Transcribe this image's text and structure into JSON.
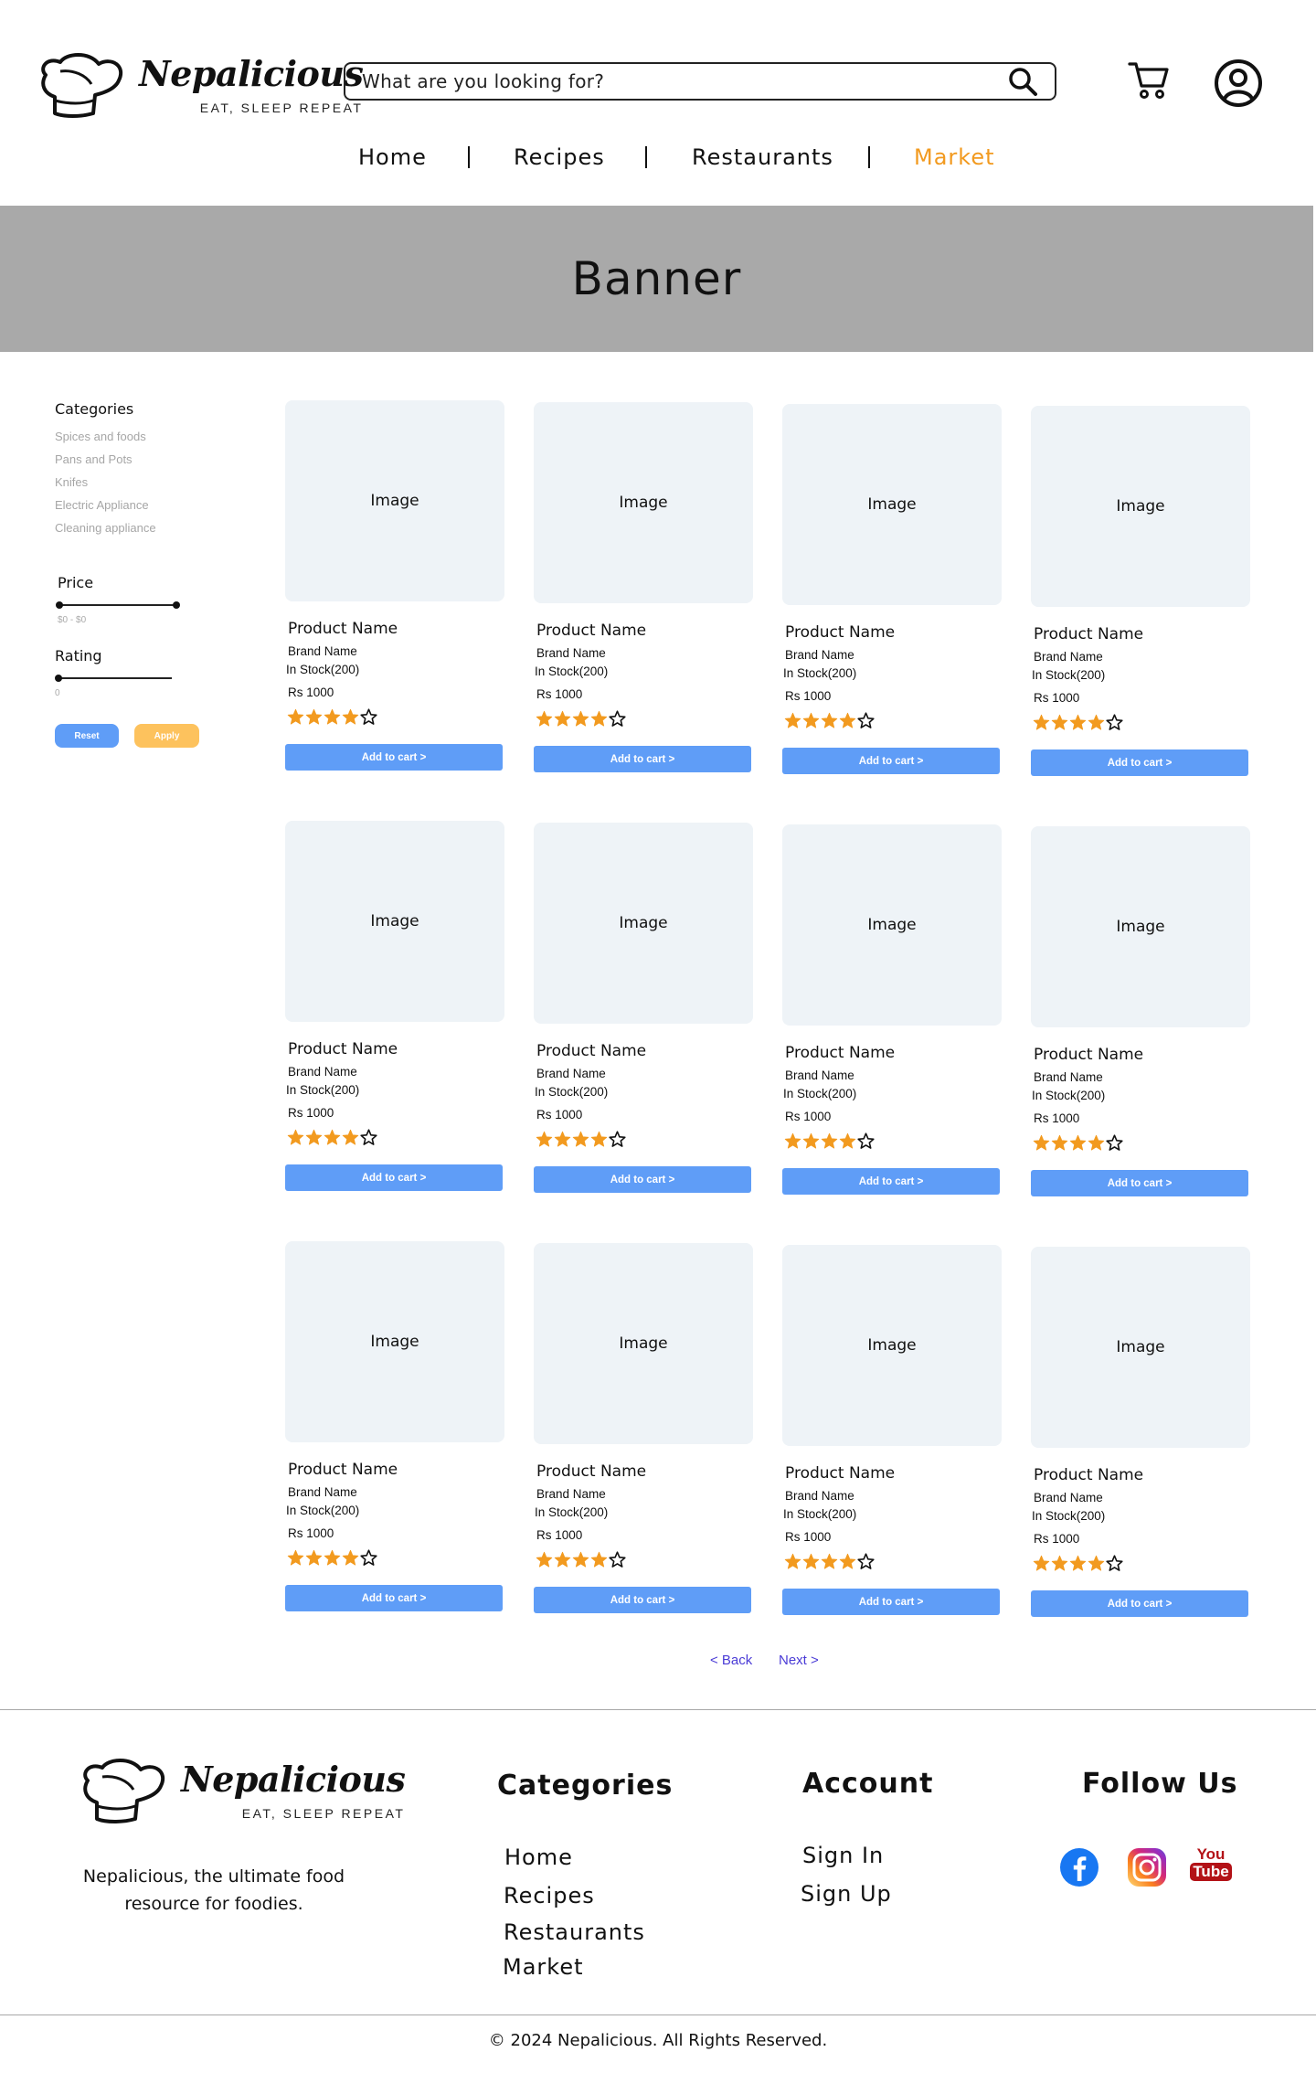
{
  "brand": {
    "name": "Nepalicious",
    "tagline": "EAT, SLEEP REPEAT"
  },
  "search": {
    "placeholder": "What are you looking for?"
  },
  "nav": {
    "items": [
      {
        "label": "Home",
        "active": false
      },
      {
        "label": "Recipes",
        "active": false
      },
      {
        "label": "Restaurants",
        "active": false
      },
      {
        "label": "Market",
        "active": true
      }
    ],
    "separator": "|"
  },
  "banner": {
    "label": "Banner"
  },
  "filters": {
    "categories_title": "Categories",
    "categories": [
      "Spices and foods",
      "Pans and Pots",
      "Knifes",
      "Electric Appliance",
      "Cleaning appliance"
    ],
    "price_title": "Price",
    "price_value": "$0 - $0",
    "rating_title": "Rating",
    "rating_value": "0",
    "reset_label": "Reset",
    "apply_label": "Apply"
  },
  "products": [
    {
      "image_label": "Image",
      "name": "Product Name",
      "brand": "Brand Name",
      "stock": "In Stock(200)",
      "price": "Rs 1000",
      "rating": 4,
      "cart_label": "Add to cart >"
    },
    {
      "image_label": "Image",
      "name": "Product Name",
      "brand": "Brand Name",
      "stock": "In Stock(200)",
      "price": "Rs 1000",
      "rating": 4,
      "cart_label": "Add to cart >"
    },
    {
      "image_label": "Image",
      "name": "Product Name",
      "brand": "Brand Name",
      "stock": "In Stock(200)",
      "price": "Rs 1000",
      "rating": 4,
      "cart_label": "Add to cart >"
    },
    {
      "image_label": "Image",
      "name": "Product Name",
      "brand": "Brand Name",
      "stock": "In Stock(200)",
      "price": "Rs 1000",
      "rating": 4,
      "cart_label": "Add to cart >"
    },
    {
      "image_label": "Image",
      "name": "Product Name",
      "brand": "Brand Name",
      "stock": "In Stock(200)",
      "price": "Rs 1000",
      "rating": 4,
      "cart_label": "Add to cart >"
    },
    {
      "image_label": "Image",
      "name": "Product Name",
      "brand": "Brand Name",
      "stock": "In Stock(200)",
      "price": "Rs 1000",
      "rating": 4,
      "cart_label": "Add to cart >"
    },
    {
      "image_label": "Image",
      "name": "Product Name",
      "brand": "Brand Name",
      "stock": "In Stock(200)",
      "price": "Rs 1000",
      "rating": 4,
      "cart_label": "Add to cart >"
    },
    {
      "image_label": "Image",
      "name": "Product Name",
      "brand": "Brand Name",
      "stock": "In Stock(200)",
      "price": "Rs 1000",
      "rating": 4,
      "cart_label": "Add to cart >"
    },
    {
      "image_label": "Image",
      "name": "Product Name",
      "brand": "Brand Name",
      "stock": "In Stock(200)",
      "price": "Rs 1000",
      "rating": 4,
      "cart_label": "Add to cart >"
    },
    {
      "image_label": "Image",
      "name": "Product Name",
      "brand": "Brand Name",
      "stock": "In Stock(200)",
      "price": "Rs 1000",
      "rating": 4,
      "cart_label": "Add to cart >"
    },
    {
      "image_label": "Image",
      "name": "Product Name",
      "brand": "Brand Name",
      "stock": "In Stock(200)",
      "price": "Rs 1000",
      "rating": 4,
      "cart_label": "Add to cart >"
    },
    {
      "image_label": "Image",
      "name": "Product Name",
      "brand": "Brand Name",
      "stock": "In Stock(200)",
      "price": "Rs 1000",
      "rating": 4,
      "cart_label": "Add to cart >"
    }
  ],
  "rating_max": 5,
  "pagination": {
    "back_label": "< Back",
    "next_label": "Next >"
  },
  "footer": {
    "description": "Nepalicious, the ultimate food resource for foodies.",
    "categories_title": "Categories",
    "categories_links": [
      "Home",
      "Recipes",
      "Restaurants",
      "Market"
    ],
    "account_title": "Account",
    "account_links": [
      "Sign In",
      "Sign Up"
    ],
    "follow_title": "Follow Us",
    "social": [
      {
        "icon": "facebook-icon",
        "label": ""
      },
      {
        "icon": "instagram-icon",
        "label": ""
      },
      {
        "icon": "youtube-icon",
        "label": "You Tube"
      }
    ],
    "copyright": "© 2024 Nepalicious. All Rights Reserved."
  },
  "colors": {
    "accent_orange": "#f29a1f",
    "button_blue": "#5f9df7",
    "button_yellow": "#fdc25d",
    "banner_gray": "#a9a9a9",
    "image_placeholder": "#eef3f7",
    "star_orange": "#f29a1f",
    "pager_link": "#4a3bd6"
  }
}
